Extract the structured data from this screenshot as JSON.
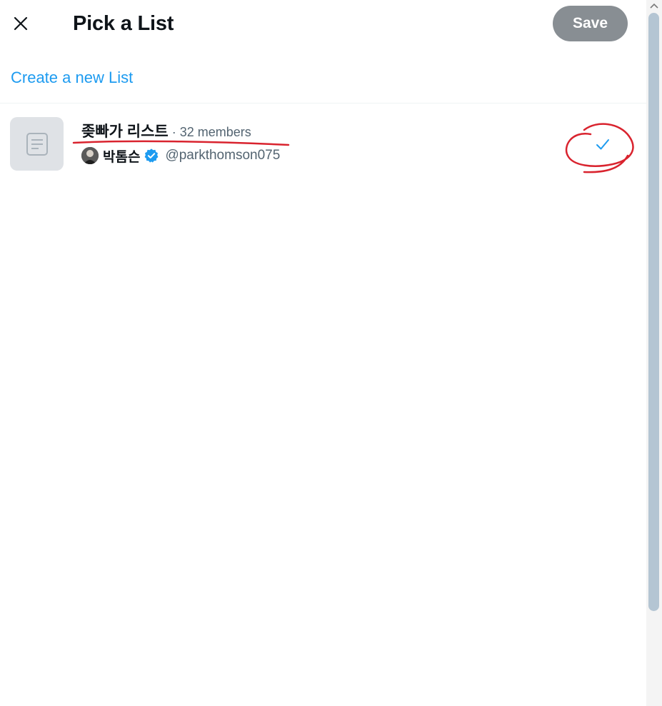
{
  "dialog": {
    "title": "Pick a List",
    "save_label": "Save",
    "create_link": "Create a new List"
  },
  "list": {
    "name": "좆빠가 리스트",
    "separator": "·",
    "members": "32 members",
    "owner_name": "박톰슨",
    "owner_handle": "@parkthomson075",
    "selected": true
  },
  "icons": {
    "close": "close-icon",
    "list": "list-icon",
    "verified": "verified-badge-icon",
    "check": "check-icon",
    "scroll_up": "chevron-up-icon"
  },
  "colors": {
    "accent": "#1d9bf0",
    "save_disabled": "#888e93",
    "annotation": "#d9232e"
  }
}
